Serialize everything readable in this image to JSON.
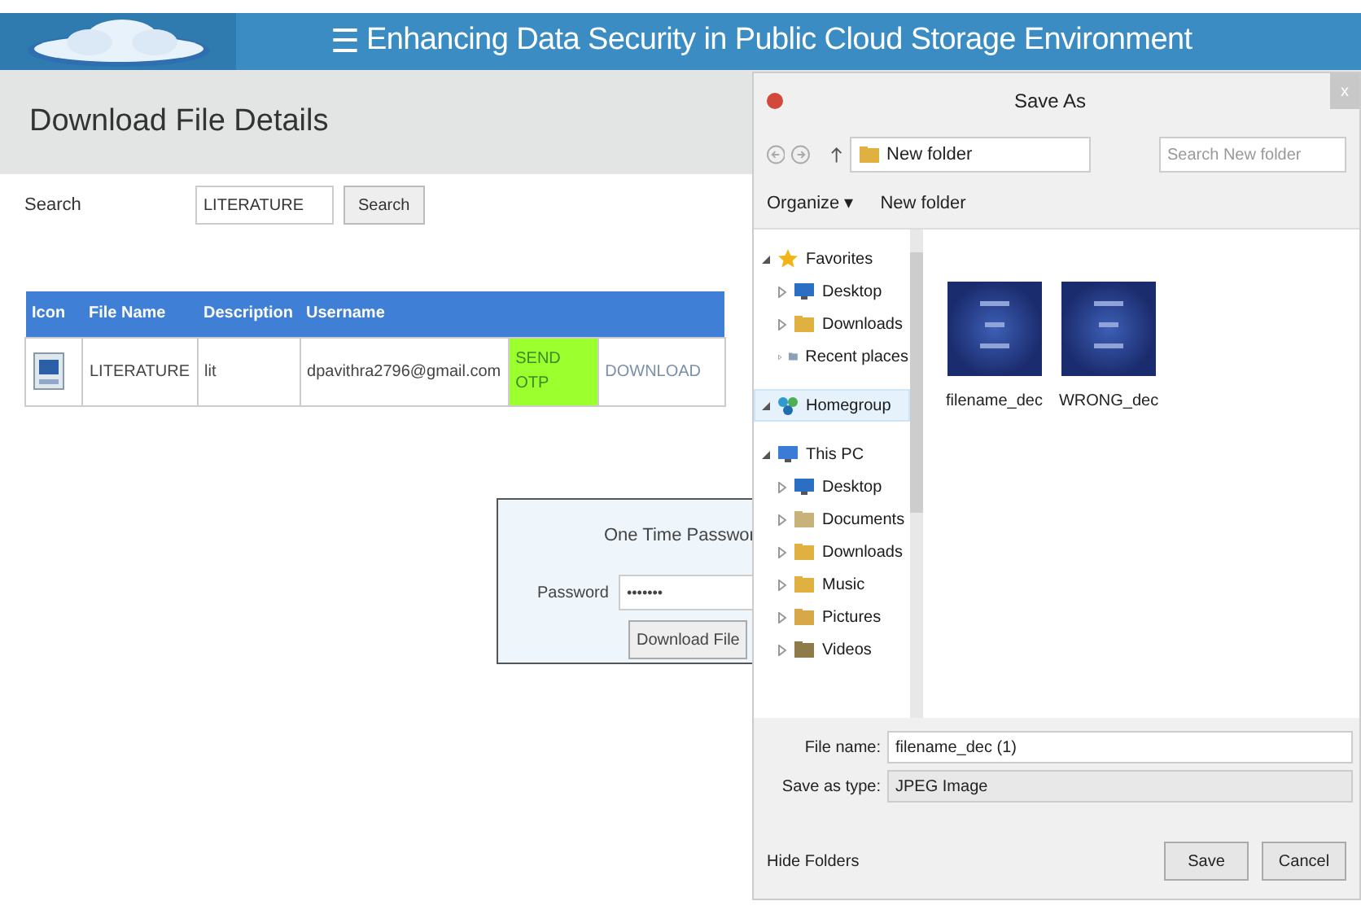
{
  "header": {
    "menu_glyph": "☰",
    "title": "Enhancing Data Security in Public Cloud Storage Environment"
  },
  "page": {
    "heading": "Download File Details",
    "search": {
      "label": "Search",
      "value": "LITERATURE",
      "button": "Search"
    },
    "table": {
      "columns": [
        "Icon",
        "File Name",
        "Description",
        "Username",
        "",
        ""
      ],
      "rows": [
        {
          "file_name": "LITERATURE",
          "description": "lit",
          "username": "dpavithra2796@gmail.com",
          "send_otp": "SEND OTP",
          "download": "DOWNLOAD"
        }
      ]
    },
    "otp": {
      "title": "One Time Passwor",
      "password_label": "Password",
      "password_value": "•••••••",
      "button": "Download File"
    }
  },
  "dialog": {
    "title": "Save As",
    "close_glyph": "x",
    "path": "New folder",
    "search_placeholder": "Search New folder",
    "toolbar": [
      "Organize ▾",
      "New folder"
    ],
    "nav": [
      {
        "label": "Favorites",
        "selected": false,
        "children": [
          {
            "label": "Desktop"
          },
          {
            "label": "Downloads"
          },
          {
            "label": "Recent places"
          }
        ]
      },
      {
        "label": "Homegroup",
        "selected": true
      },
      {
        "label": "This PC",
        "selected": false,
        "children": [
          {
            "label": "Desktop"
          },
          {
            "label": "Documents"
          },
          {
            "label": "Downloads"
          },
          {
            "label": "Music"
          },
          {
            "label": "Pictures"
          },
          {
            "label": "Videos"
          }
        ]
      }
    ],
    "files": [
      {
        "name": "filename_dec",
        "kind": "picture"
      },
      {
        "name": "WRONG_dec",
        "kind": "picture"
      }
    ],
    "file_name": {
      "label": "File name:",
      "value": "filename_dec (1)"
    },
    "save_type": {
      "label": "Save as type:",
      "value": "JPEG Image"
    },
    "hide_folders": "Hide Folders",
    "buttons": [
      "Save",
      "Cancel"
    ]
  }
}
